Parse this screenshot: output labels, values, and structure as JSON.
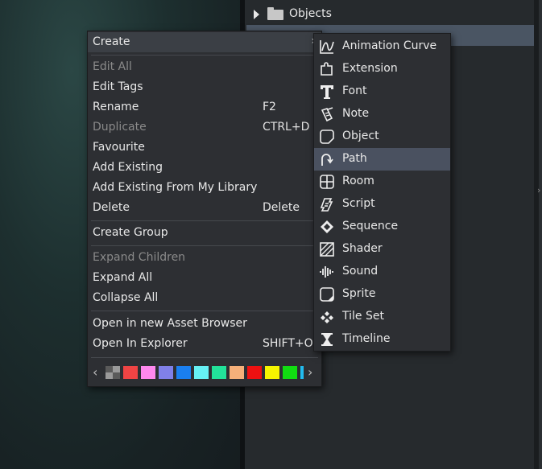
{
  "tree": {
    "items": [
      {
        "label": "Objects"
      }
    ]
  },
  "menu": {
    "create_label": "Create",
    "items": [
      {
        "label": "Edit All",
        "shortcut": "",
        "disabled": true
      },
      {
        "label": "Edit Tags",
        "shortcut": "",
        "disabled": false
      },
      {
        "label": "Rename",
        "shortcut": "F2",
        "disabled": false
      },
      {
        "label": "Duplicate",
        "shortcut": "CTRL+D",
        "disabled": true
      },
      {
        "label": "Favourite",
        "shortcut": "",
        "disabled": false
      },
      {
        "label": "Add Existing",
        "shortcut": "",
        "disabled": false
      },
      {
        "label": "Add Existing From My Library",
        "shortcut": "",
        "disabled": false
      },
      {
        "label": "Delete",
        "shortcut": "Delete",
        "disabled": false
      },
      {
        "label": "Create Group",
        "shortcut": "",
        "disabled": false
      },
      {
        "label": "Expand Children",
        "shortcut": "",
        "disabled": true
      },
      {
        "label": "Expand All",
        "shortcut": "",
        "disabled": false
      },
      {
        "label": "Collapse All",
        "shortcut": "",
        "disabled": false
      },
      {
        "label": "Open in new Asset Browser",
        "shortcut": "",
        "disabled": false
      },
      {
        "label": "Open In Explorer",
        "shortcut": "SHIFT+O",
        "disabled": false
      }
    ],
    "colors": [
      "#8a8a8a",
      "#ef4444",
      "#ff88ee",
      "#8080e8",
      "#1a7ff0",
      "#66f0f4",
      "#22e29a",
      "#f5b07a",
      "#ee1111",
      "#f5f500",
      "#11dd11",
      "#22bbee"
    ],
    "color_icons": {
      "left": "chevron-left-icon",
      "right": "chevron-right-icon",
      "none": "checker-swatch-icon"
    }
  },
  "submenu": {
    "items": [
      {
        "label": "Animation Curve",
        "icon": "animation-curve-icon"
      },
      {
        "label": "Extension",
        "icon": "extension-icon"
      },
      {
        "label": "Font",
        "icon": "font-icon"
      },
      {
        "label": "Note",
        "icon": "note-icon"
      },
      {
        "label": "Object",
        "icon": "object-icon"
      },
      {
        "label": "Path",
        "icon": "path-icon"
      },
      {
        "label": "Room",
        "icon": "room-icon"
      },
      {
        "label": "Script",
        "icon": "script-icon"
      },
      {
        "label": "Sequence",
        "icon": "sequence-icon"
      },
      {
        "label": "Shader",
        "icon": "shader-icon"
      },
      {
        "label": "Sound",
        "icon": "sound-icon"
      },
      {
        "label": "Sprite",
        "icon": "sprite-icon"
      },
      {
        "label": "Tile Set",
        "icon": "tile-set-icon"
      },
      {
        "label": "Timeline",
        "icon": "timeline-icon"
      }
    ],
    "highlighted": "Path"
  }
}
